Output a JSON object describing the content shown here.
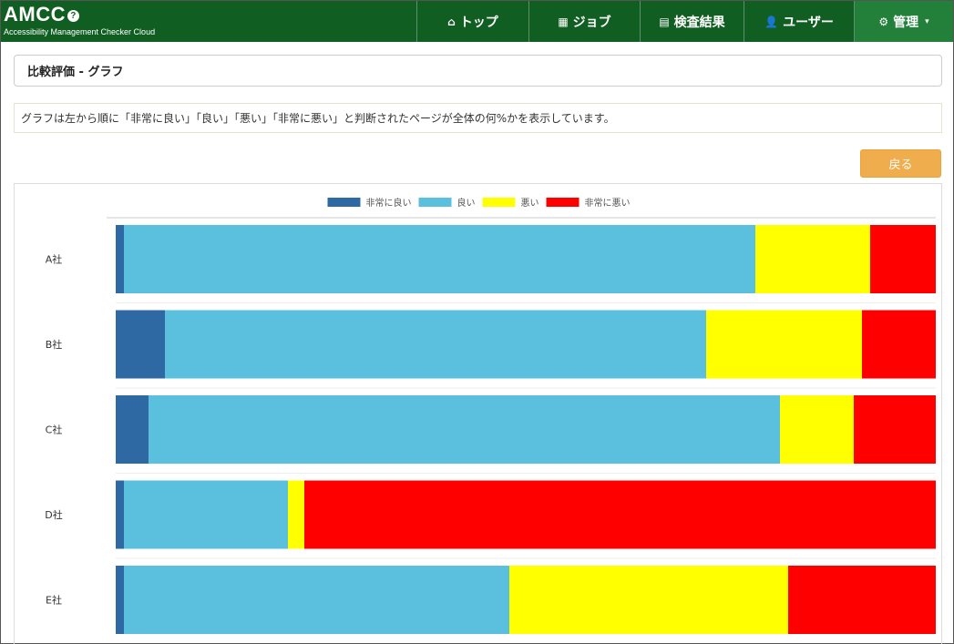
{
  "brand": {
    "title": "AMCC",
    "help_icon": "question-circle-icon",
    "subtitle": "Accessibility Management Checker Cloud"
  },
  "nav": {
    "items": [
      {
        "label": "トップ",
        "icon": "home-icon"
      },
      {
        "label": "ジョブ",
        "icon": "calendar-icon"
      },
      {
        "label": "検査結果",
        "icon": "list-alt-icon"
      },
      {
        "label": "ユーザー",
        "icon": "user-add-icon"
      },
      {
        "label": "管理",
        "icon": "cog-icon",
        "caret": "▾",
        "active": true
      }
    ]
  },
  "page": {
    "title": "比較評価 - グラフ",
    "description": "グラフは左から順に「非常に良い」「良い」「悪い」「非常に悪い」と判断されたページが全体の何%かを表示しています。",
    "back_label": "戻る"
  },
  "colors": {
    "nav_bg": "#115e22",
    "nav_active": "#23803b",
    "back_button": "#f0ad4e"
  },
  "chart_data": {
    "type": "bar",
    "orientation": "horizontal",
    "stacked": true,
    "percent": true,
    "categories": [
      "A社",
      "B社",
      "C社",
      "D社",
      "E社"
    ],
    "series": [
      {
        "name": "非常に良い",
        "color": "#2f69a3",
        "values": [
          1,
          6,
          4,
          1,
          1
        ]
      },
      {
        "name": "良い",
        "color": "#5bc0de",
        "values": [
          77,
          66,
          77,
          20,
          47
        ]
      },
      {
        "name": "悪い",
        "color": "#ffff00",
        "values": [
          14,
          19,
          9,
          2,
          34
        ]
      },
      {
        "name": "非常に悪い",
        "color": "#ff0000",
        "values": [
          8,
          9,
          10,
          77,
          18
        ]
      }
    ],
    "xlim": [
      0,
      100
    ],
    "legend_position": "top-center",
    "grid": true
  }
}
